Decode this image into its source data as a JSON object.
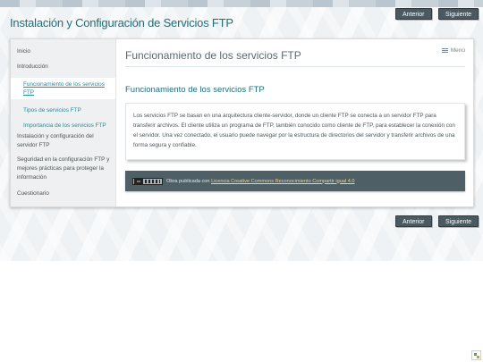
{
  "site": {
    "title": "Instalación y Configuración de Servicios FTP"
  },
  "nav": {
    "prev_label": "Anterior",
    "next_label": "Siguiente"
  },
  "sidebar": {
    "items": [
      {
        "label": "Inicio"
      },
      {
        "label": "Introducción"
      },
      {
        "label": "Funcionamiento de los servicios FTP"
      },
      {
        "label": "Tipos de servicios FTP"
      },
      {
        "label": "Importancia de los servicios FTP"
      },
      {
        "label": "Instalación y configuración del servidor FTP"
      },
      {
        "label": "Seguridad en la configuración FTP y mejores prácticas para proteger la información"
      },
      {
        "label": "Cuestionario"
      }
    ]
  },
  "main": {
    "page_title": "Funcionamiento de los servicios FTP",
    "menu_label": "Menú",
    "section_title": "Funcionamiento de los servicios FTP",
    "paragraph": "Los servicios FTP se basan en una arquitectura cliente-servidor, donde un cliente FTP se conecta a un servidor FTP para transferir archivos. El cliente utiliza un programa de FTP, también conocido como cliente de FTP, para establecer la conexión con el servidor. Una vez conectado, el usuario puede navegar por la estructura de directorios del servidor y transferir archivos de una forma segura y confiable."
  },
  "license": {
    "prefix": "Obra publicada con ",
    "link_text": "Licencia Creative Commons Reconocimiento Compartir igual 4.0",
    "badge_text": "cc"
  },
  "icons": {
    "menu": "hamburger-icon",
    "license": "creative-commons-badge",
    "corner": "exelearning-icon"
  },
  "colors": {
    "accent": "#1f6e7a",
    "button": "#4a5a60",
    "license_bar": "#4f5f66",
    "link": "#2b8a98"
  }
}
